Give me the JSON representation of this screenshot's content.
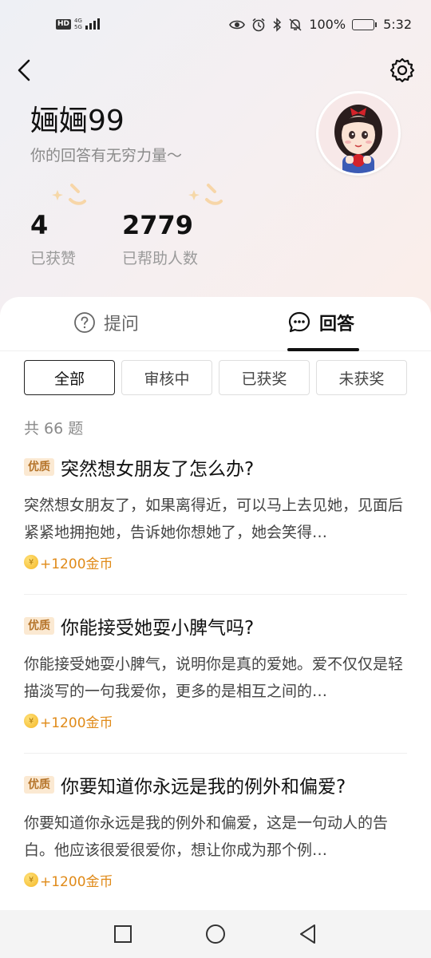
{
  "status_bar": {
    "hd": "HD",
    "network": [
      "4G",
      "5G"
    ],
    "battery": "100%",
    "time": "5:32"
  },
  "profile": {
    "username": "婳婳99",
    "tagline": "你的回答有无穷力量～",
    "stats": [
      {
        "value": "4",
        "label": "已获赞"
      },
      {
        "value": "2779",
        "label": "已帮助人数"
      }
    ]
  },
  "tabs": [
    {
      "label": "提问",
      "icon": "question-circle-icon"
    },
    {
      "label": "回答",
      "icon": "chat-bubble-icon"
    }
  ],
  "filters": [
    "全部",
    "审核中",
    "已获奖",
    "未获奖"
  ],
  "count_text": "共 66 题",
  "answers": [
    {
      "badge": "优质",
      "title": "突然想女朋友了怎么办?",
      "body": "突然想女朋友了，如果离得近，可以马上去见她，见面后紧紧地拥抱她，告诉她你想她了，她会笑得…",
      "reward": "+1200金币"
    },
    {
      "badge": "优质",
      "title": "你能接受她耍小脾气吗?",
      "body": "你能接受她耍小脾气，说明你是真的爱她。爱不仅仅是轻描淡写的一句我爱你，更多的是相互之间的…",
      "reward": "+1200金币"
    },
    {
      "badge": "优质",
      "title": "你要知道你永远是我的例外和偏爱?",
      "body": "你要知道你永远是我的例外和偏爱，这是一句动人的告白。他应该很爱很爱你，想让你成为那个例…",
      "reward": "+1200金币"
    }
  ],
  "colors": {
    "accent_gold": "#e08a18",
    "badge_bg": "#fbe9d2",
    "badge_text": "#b5742a"
  }
}
